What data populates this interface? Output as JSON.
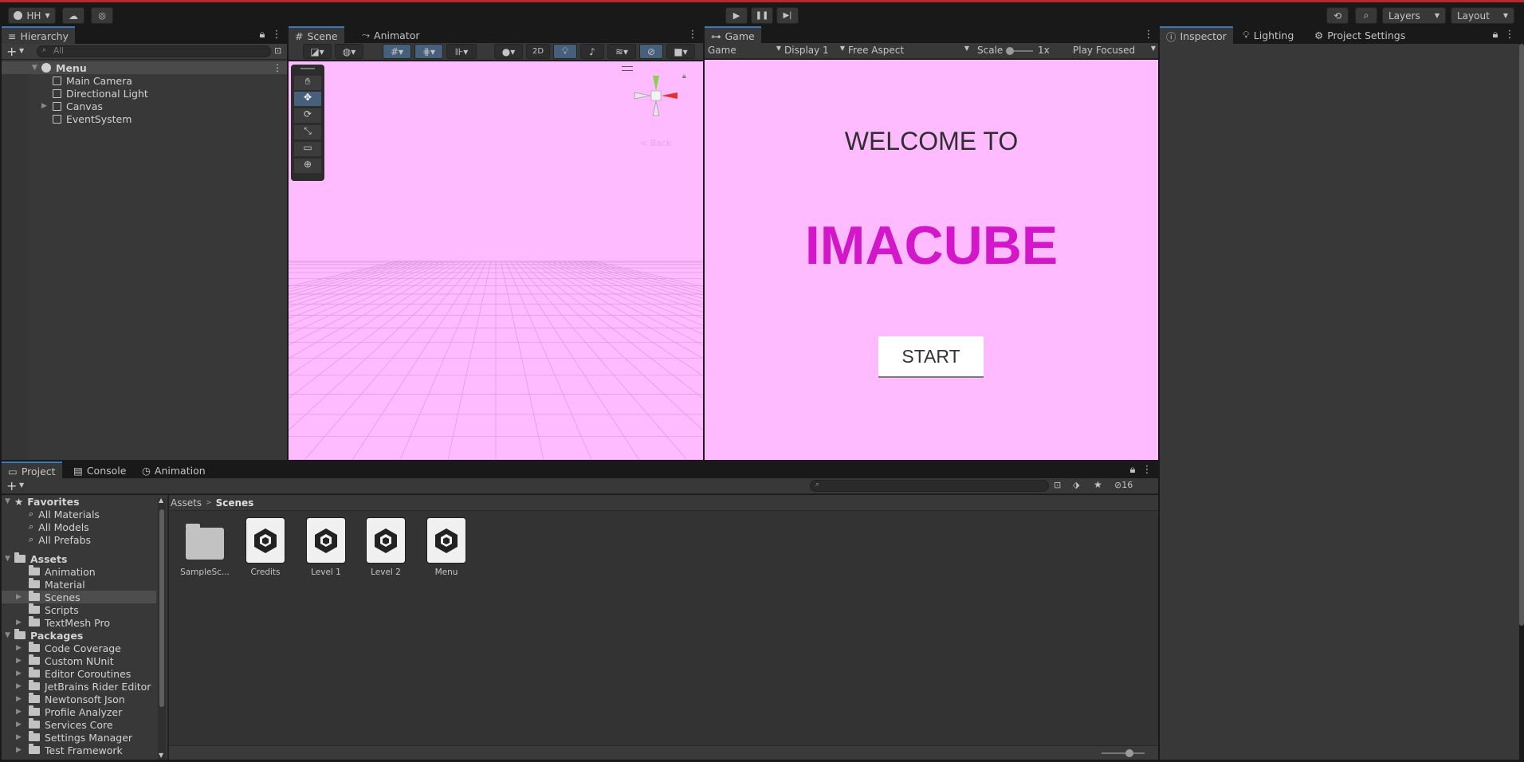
{
  "toolbar": {
    "account": "HH",
    "layers": "Layers",
    "layout": "Layout"
  },
  "hierarchy": {
    "tab": "Hierarchy",
    "search_placeholder": "All",
    "scene": "Menu",
    "items": [
      "Main Camera",
      "Directional Light",
      "Canvas",
      "EventSystem"
    ]
  },
  "scene_view": {
    "tabs": [
      "Scene",
      "Animator"
    ],
    "mode_2d": "2D",
    "gizmo_label": "< Back"
  },
  "game_view": {
    "tab": "Game",
    "game_select": "Game",
    "display": "Display 1",
    "aspect": "Free Aspect",
    "scale_label": "Scale",
    "scale_value": "1x",
    "play_mode": "Play Focused",
    "welcome": "WELCOME TO",
    "title": "IMACUBE",
    "start": "START",
    "bg_color": "#ffbbff",
    "title_color": "#d316c9"
  },
  "inspector": {
    "tabs": [
      "Inspector",
      "Lighting",
      "Project Settings"
    ]
  },
  "project": {
    "tabs": [
      "Project",
      "Console",
      "Animation"
    ],
    "hidden_count": "16",
    "breadcrumb": [
      "Assets",
      "Scenes"
    ],
    "favorites": {
      "label": "Favorites",
      "items": [
        "All Materials",
        "All Models",
        "All Prefabs"
      ]
    },
    "assets": {
      "label": "Assets",
      "items": [
        "Animation",
        "Material",
        "Scenes",
        "Scripts",
        "TextMesh Pro"
      ]
    },
    "packages": {
      "label": "Packages",
      "items": [
        "Code Coverage",
        "Custom NUnit",
        "Editor Coroutines",
        "JetBrains Rider Editor",
        "Newtonsoft Json",
        "Profile Analyzer",
        "Services Core",
        "Settings Manager",
        "Test Framework"
      ]
    },
    "files": [
      "SampleSc...",
      "Credits",
      "Level 1",
      "Level 2",
      "Menu"
    ]
  }
}
